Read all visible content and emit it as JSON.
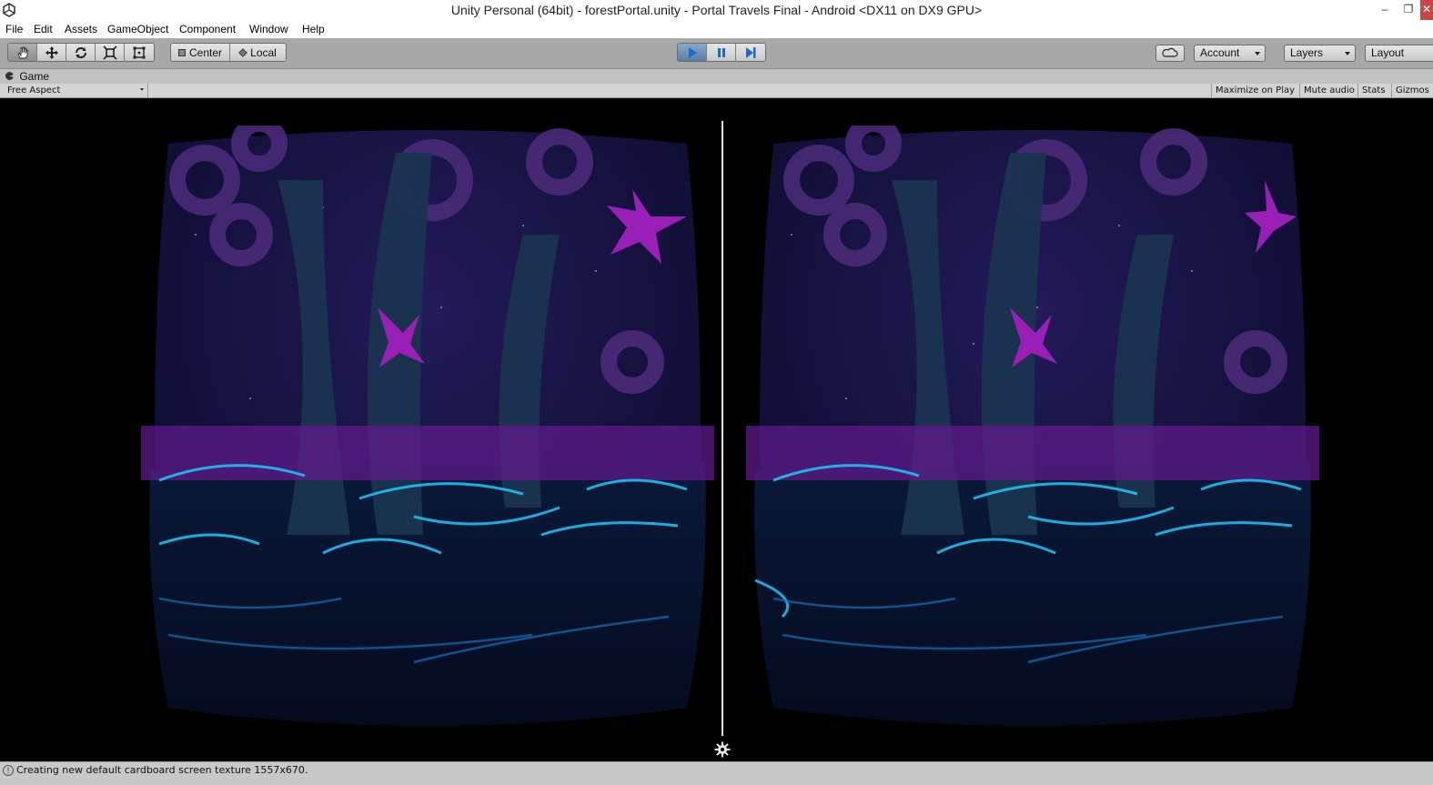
{
  "window": {
    "title": "Unity Personal (64bit) - forestPortal.unity - Portal Travels Final - Android <DX11 on DX9 GPU>",
    "minimize": "–",
    "restore": "❐",
    "close": "✕"
  },
  "menu": [
    "File",
    "Edit",
    "Assets",
    "GameObject",
    "Component",
    "Window",
    "Help"
  ],
  "toolbar": {
    "tools": [
      "hand-icon",
      "move-icon",
      "rotate-icon",
      "scale-icon",
      "rect-icon"
    ],
    "pivot_label": "Center",
    "space_label": "Local",
    "account_label": "Account",
    "layers_label": "Layers",
    "layout_label": "Layout"
  },
  "game_view": {
    "tab_label": "Game",
    "aspect_label": "Free Aspect",
    "maximize_label": "Maximize on Play",
    "mute_label": "Mute audio",
    "stats_label": "Stats",
    "gizmos_label": "Gizmos"
  },
  "status": {
    "message": "Creating new default cardboard screen texture 1557x670."
  },
  "colors": {
    "toolbar": "#a8a8a8",
    "play_active": "#5a7ea4",
    "scene_glow": "#1ec8ff",
    "scene_purple": "#8a1fa8"
  }
}
